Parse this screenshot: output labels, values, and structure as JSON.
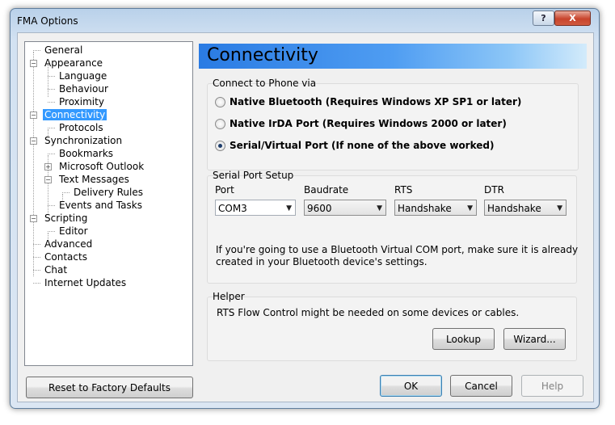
{
  "window": {
    "title": "FMA Options",
    "help_glyph": "?",
    "close_glyph": "X"
  },
  "tree": [
    {
      "label": "General",
      "level": 0,
      "expander": ""
    },
    {
      "label": "Appearance",
      "level": 0,
      "expander": "−"
    },
    {
      "label": "Language",
      "level": 1,
      "expander": ""
    },
    {
      "label": "Behaviour",
      "level": 1,
      "expander": ""
    },
    {
      "label": "Proximity",
      "level": 1,
      "expander": ""
    },
    {
      "label": "Connectivity",
      "level": 0,
      "expander": "−",
      "selected": true
    },
    {
      "label": "Protocols",
      "level": 1,
      "expander": ""
    },
    {
      "label": "Synchronization",
      "level": 0,
      "expander": "−"
    },
    {
      "label": "Bookmarks",
      "level": 1,
      "expander": ""
    },
    {
      "label": "Microsoft Outlook",
      "level": 1,
      "expander": "+"
    },
    {
      "label": "Text Messages",
      "level": 1,
      "expander": "−"
    },
    {
      "label": "Delivery Rules",
      "level": 2,
      "expander": ""
    },
    {
      "label": "Events and Tasks",
      "level": 1,
      "expander": ""
    },
    {
      "label": "Scripting",
      "level": 0,
      "expander": "−"
    },
    {
      "label": "Editor",
      "level": 1,
      "expander": ""
    },
    {
      "label": "Advanced",
      "level": 0,
      "expander": ""
    },
    {
      "label": "Contacts",
      "level": 0,
      "expander": ""
    },
    {
      "label": "Chat",
      "level": 0,
      "expander": ""
    },
    {
      "label": "Internet Updates",
      "level": 0,
      "expander": ""
    }
  ],
  "reset_label": "Reset to Factory Defaults",
  "page": {
    "title": "Connectivity",
    "connect_group": {
      "label": "Connect to Phone via",
      "options": [
        {
          "label": "Native Bluetooth (Requires Windows XP SP1 or later)",
          "checked": false
        },
        {
          "label": "Native IrDA Port (Requires Windows 2000 or later)",
          "checked": false
        },
        {
          "label": "Serial/Virtual Port (If none of the above worked)",
          "checked": true
        }
      ]
    },
    "serial_group": {
      "label": "Serial Port Setup",
      "port_label": "Port",
      "port_value": "COM3",
      "baud_label": "Baudrate",
      "baud_value": "9600",
      "rts_label": "RTS",
      "rts_value": "Handshake",
      "dtr_label": "DTR",
      "dtr_value": "Handshake",
      "note_line1": "If you're going to use a Bluetooth Virtual COM port, make sure it is already",
      "note_line2": "created in your Bluetooth device's settings."
    },
    "helper_group": {
      "label": "Helper",
      "text": "RTS Flow Control might be needed on some devices or cables.",
      "lookup_label": "Lookup",
      "wizard_label": "Wizard..."
    }
  },
  "footer": {
    "ok_label": "OK",
    "cancel_label": "Cancel",
    "help_label": "Help"
  },
  "dropdown_arrow": "▼"
}
